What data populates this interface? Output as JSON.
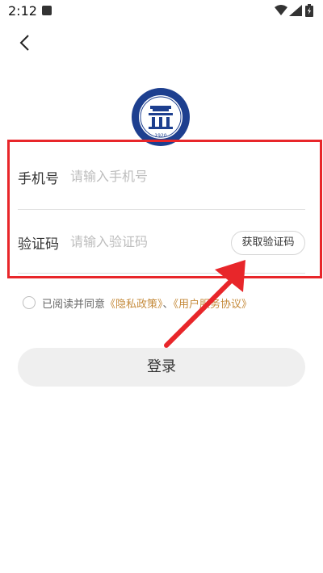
{
  "status_bar": {
    "time": "2:12"
  },
  "login_form": {
    "phone_label": "手机号",
    "phone_placeholder": "请输入手机号",
    "code_label": "验证码",
    "code_placeholder": "请输入验证码",
    "get_code_label": "获取验证码"
  },
  "agreement": {
    "prefix": "已阅读并同意",
    "privacy_link": "《隐私政策》",
    "separator": "、",
    "terms_link": "《用户服务协议》"
  },
  "login_button": {
    "label": "登录"
  },
  "logo": {
    "year": "1920"
  },
  "colors": {
    "highlight": "#e8262a",
    "link": "#c58a3a",
    "logo_blue": "#1d3f8f"
  }
}
